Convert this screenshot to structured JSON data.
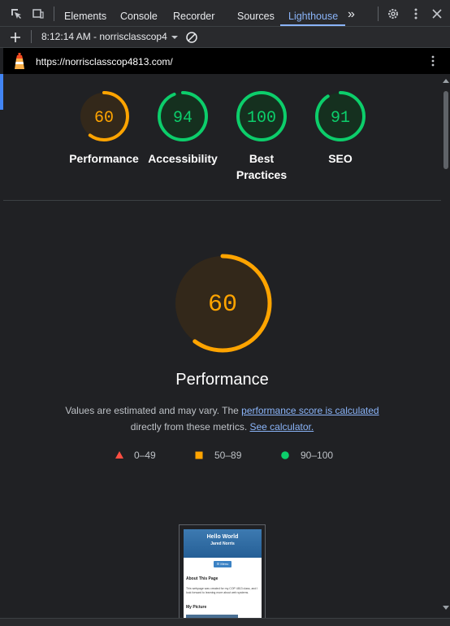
{
  "devtools": {
    "tabs": [
      "Elements",
      "Console",
      "Recorder",
      "Sources",
      "Lighthouse"
    ],
    "active_tab": "Lighthouse",
    "more_tabs_glyph": "»"
  },
  "report": {
    "selector": "8:12:14 AM - norrisclasscop4",
    "url": "https://norrisclasscop4813.com/"
  },
  "scores": [
    {
      "label": "Performance",
      "value": "60",
      "numeric": 60,
      "status": "average"
    },
    {
      "label": "Accessibility",
      "value": "94",
      "numeric": 94,
      "status": "pass"
    },
    {
      "label": "Best Practices",
      "value": "100",
      "numeric": 100,
      "status": "pass"
    },
    {
      "label": "SEO",
      "value": "91",
      "numeric": 91,
      "status": "pass"
    }
  ],
  "performance": {
    "title": "Performance",
    "score": "60",
    "score_numeric": 60,
    "desc_prefix": "Values are estimated and may vary. The ",
    "desc_link1": "performance score is calculated",
    "desc_middle": " directly from these metrics. ",
    "desc_link2": "See calculator."
  },
  "legend": [
    {
      "range": "0–49",
      "shape": "triangle",
      "color": "#ff4e42"
    },
    {
      "range": "50–89",
      "shape": "square",
      "color": "#ffa400"
    },
    {
      "range": "90–100",
      "shape": "circle",
      "color": "#0cce6b"
    }
  ],
  "screenshot": {
    "title": "Hello World",
    "subtitle": "Jared Norris",
    "menu_button": "☰ Menu",
    "about_heading": "About This Page",
    "about_text": "This webpage was created for my COP 4813 class, and I look forward to learning more about web systems.",
    "picture_heading": "My Picture"
  },
  "colors": {
    "average": "#ffa400",
    "average_bg": "#33281a",
    "pass": "#0cce6b",
    "pass_bg": "#15301f",
    "link": "#8ab4f8"
  }
}
